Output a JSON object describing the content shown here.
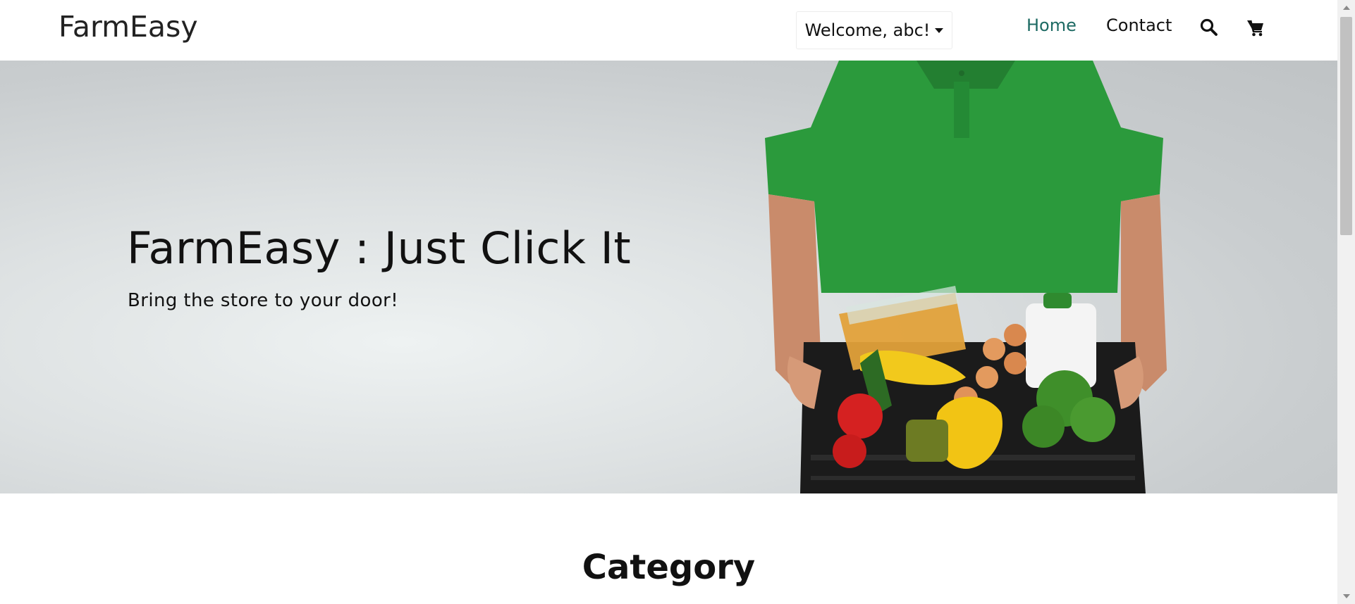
{
  "navbar": {
    "brand": "FarmEasy",
    "welcome_label": "Welcome, abc!",
    "links": [
      {
        "label": "Home",
        "active": true
      },
      {
        "label": "Contact",
        "active": false
      }
    ],
    "icons": [
      "search-icon",
      "cart-icon"
    ],
    "colors": {
      "active_link": "#1d6a63",
      "text": "#111111"
    }
  },
  "hero": {
    "title": "FarmEasy : Just Click It",
    "subtitle": "Bring the store to your door!",
    "image_subject": "delivery-person-holding-grocery-crate"
  },
  "category": {
    "heading": "Category"
  }
}
